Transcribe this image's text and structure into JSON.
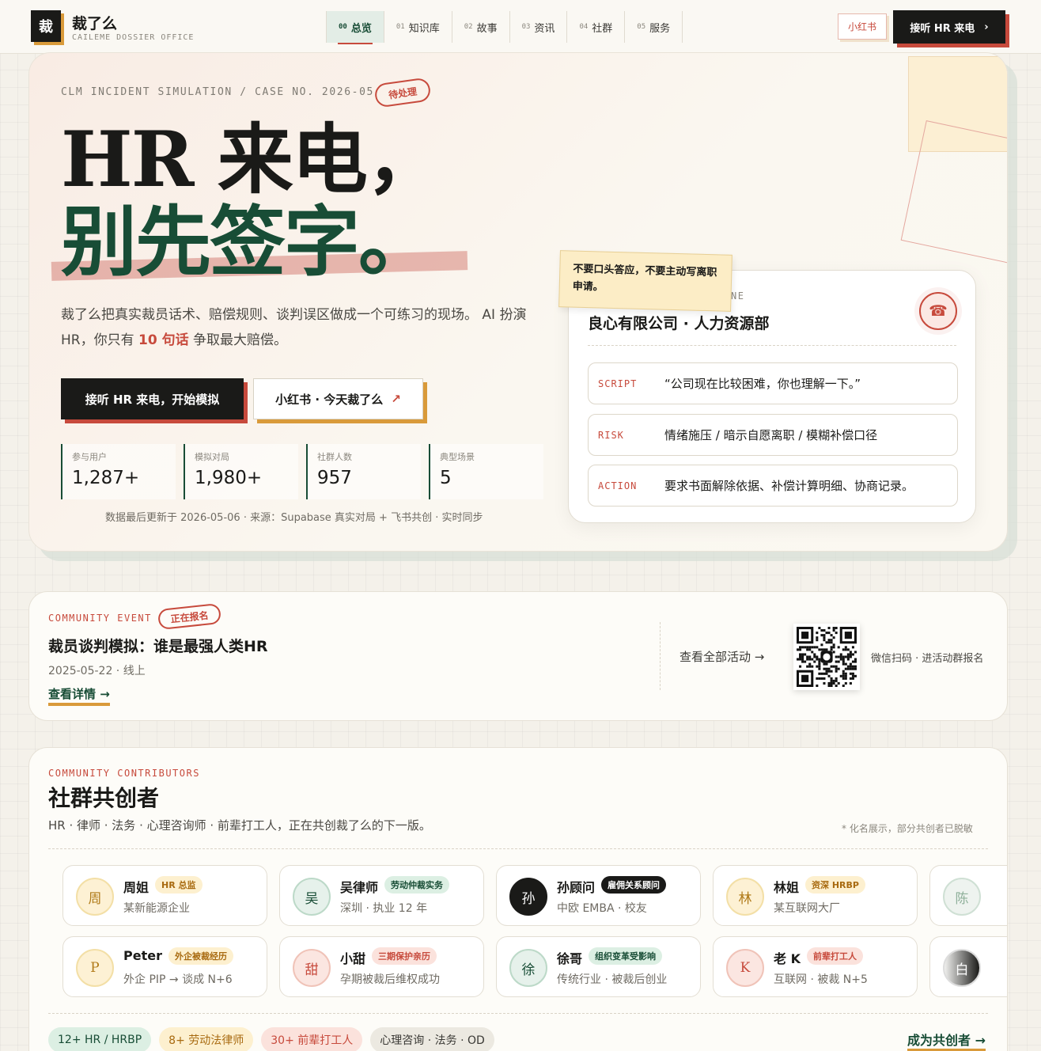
{
  "header": {
    "logo_char": "裁",
    "brand": "裁了么",
    "brand_sub": "CAILEME DOSSIER OFFICE",
    "nav": [
      {
        "num": "00",
        "label": "总览",
        "active": true
      },
      {
        "num": "01",
        "label": "知识库"
      },
      {
        "num": "02",
        "label": "故事"
      },
      {
        "num": "03",
        "label": "资讯"
      },
      {
        "num": "04",
        "label": "社群"
      },
      {
        "num": "05",
        "label": "服务"
      }
    ],
    "xhs": "小红书",
    "call": "接听 HR 来电",
    "call_icon": "›"
  },
  "hero": {
    "case": "CLM INCIDENT SIMULATION / CASE NO. 2026-05",
    "stamp": "待处理",
    "title1": "HR 来电，",
    "title2": "别先签字。",
    "lead_a": "裁了么把真实裁员话术、赔偿规则、谈判误区做成一个可练习的现场。 AI 扮演 HR，你只有 ",
    "lead_hl": "10 句话",
    "lead_b": " 争取最大赔偿。",
    "btn_primary": "接听 HR 来电，开始模拟",
    "btn_secondary": "小红书 · 今天裁了么",
    "btn_secondary_icon": "↗",
    "stats": [
      {
        "k": "参与用户",
        "v": "1,287+"
      },
      {
        "k": "模拟对局",
        "v": "1,980+"
      },
      {
        "k": "社群人数",
        "v": "957"
      },
      {
        "k": "典型场景",
        "v": "5"
      }
    ],
    "updated": "数据最后更新于 2026-05-06 · 来源：Supabase 真实对局 + 飞书共创 · 实时同步"
  },
  "phone": {
    "label_fragment": "NE",
    "title": "良心有限公司 · 人力资源部",
    "icon": "☎",
    "note": "不要口头答应，不要主动写离职申请。",
    "rows": [
      {
        "tag": "SCRIPT",
        "text": "“公司现在比较困难，你也理解一下。”"
      },
      {
        "tag": "RISK",
        "text": "情绪施压 / 暗示自愿离职 / 模糊补偿口径"
      },
      {
        "tag": "ACTION",
        "text": "要求书面解除依据、补偿计算明细、协商记录。"
      }
    ]
  },
  "event": {
    "kicker": "COMMUNITY EVENT",
    "stamp": "正在报名",
    "title": "裁员谈判模拟：谁是最强人类HR",
    "date": "2025-05-22 · 线上",
    "link": "查看详情 →",
    "all": "查看全部活动 →",
    "qr_text": "微信扫码 · 进活动群报名"
  },
  "contrib": {
    "kicker": "COMMUNITY CONTRIBUTORS",
    "title": "社群共创者",
    "sub": "HR · 律师 · 法务 · 心理咨询师 · 前辈打工人，正在共创裁了么的下一版。",
    "note": "* 化名展示，部分共创者已脱敏",
    "row1": [
      {
        "av": "周",
        "name": "周姐",
        "badge": "HR 总监",
        "desc": "某新能源企业",
        "c": "y"
      },
      {
        "av": "吴",
        "name": "吴律师",
        "badge": "劳动仲裁实务",
        "desc": "深圳 · 执业 12 年",
        "c": "g"
      },
      {
        "av": "孙",
        "name": "孙顾问",
        "badge": "雇佣关系顾问",
        "desc": "中欧 EMBA · 校友",
        "c": "d"
      },
      {
        "av": "林",
        "name": "林姐",
        "badge": "资深 HRBP",
        "desc": "某互联网大厂",
        "c": "y"
      },
      {
        "av": "陈",
        "name": "",
        "badge": "",
        "desc": "",
        "c": "g2"
      }
    ],
    "row2": [
      {
        "av": "P",
        "name": "Peter",
        "badge": "外企被裁经历",
        "desc": "外企 PIP → 谈成 N+6",
        "c": "y"
      },
      {
        "av": "甜",
        "name": "小甜",
        "badge": "三期保护亲历",
        "desc": "孕期被裁后维权成功",
        "c": "r"
      },
      {
        "av": "徐",
        "name": "徐哥",
        "badge": "组织变革受影响",
        "desc": "传统行业 · 被裁后创业",
        "c": "g"
      },
      {
        "av": "K",
        "name": "老 K",
        "badge": "前辈打工人",
        "desc": "互联网 · 被裁 N+5",
        "c": "r"
      },
      {
        "av": "白",
        "name": "",
        "badge": "",
        "desc": "",
        "c": "gr"
      }
    ],
    "pills": [
      {
        "t": "12+ HR / HRBP",
        "bg": "#dcefe3",
        "fg": "#184d36"
      },
      {
        "t": "8+ 劳动法律师",
        "bg": "#fdf0cf",
        "fg": "#a86a10"
      },
      {
        "t": "30+ 前辈打工人",
        "bg": "#fbe2dc",
        "fg": "#c74a3c"
      },
      {
        "t": "心理咨询 · 法务 · OD",
        "bg": "#ece9e1",
        "fg": "#3a3935"
      }
    ],
    "link": "成为共创者 →"
  }
}
